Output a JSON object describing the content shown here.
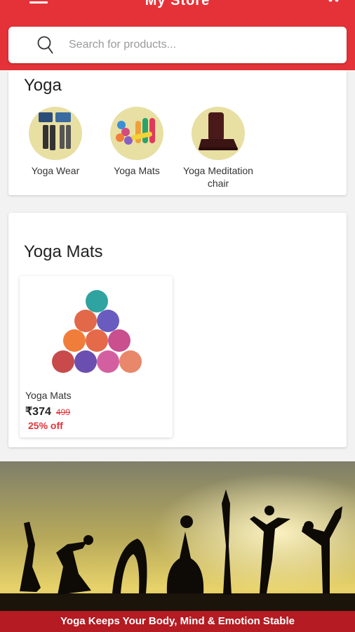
{
  "header": {
    "brand": "My Store",
    "accent_color": "#e53238"
  },
  "search": {
    "placeholder": "Search for products..."
  },
  "categories": {
    "title": "Yoga",
    "items": [
      {
        "label": "Yoga Wear"
      },
      {
        "label": "Yoga Mats"
      },
      {
        "label": "Yoga Meditation chair"
      }
    ]
  },
  "section": {
    "title": "Yoga Mats",
    "product": {
      "name": "Yoga Mats",
      "price": "₹374",
      "old_price": "499",
      "discount": "25% off"
    }
  },
  "banner": {
    "caption": "Yoga Keeps Your Body, Mind & Emotion Stable"
  }
}
